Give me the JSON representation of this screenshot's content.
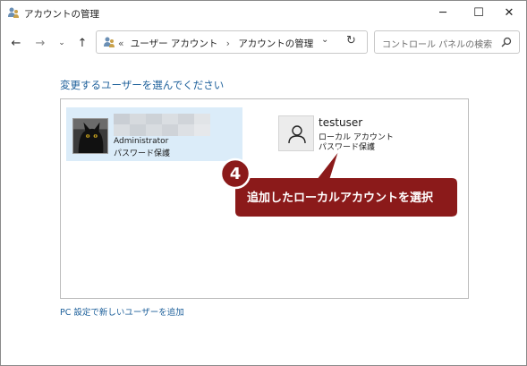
{
  "window": {
    "title": "アカウントの管理",
    "controls": {
      "minimize": "─",
      "maximize": "☐",
      "close": "✕"
    }
  },
  "nav": {
    "back_icon": "←",
    "forward_icon": "→",
    "recent_icon": "⌄",
    "up_icon": "↑"
  },
  "address": {
    "overflow": "«",
    "crumbs": [
      "ユーザー アカウント",
      "アカウントの管理"
    ],
    "separator": "›",
    "dropdown_icon": "⌄",
    "refresh_icon": "↻"
  },
  "search": {
    "placeholder": "コントロール パネルの検索"
  },
  "main": {
    "heading": "変更するユーザーを選んでください",
    "accounts": [
      {
        "name": "",
        "role": "Administrator",
        "password": "パスワード保護",
        "selected": true
      },
      {
        "name": "testuser",
        "role": "ローカル アカウント",
        "password": "パスワード保護",
        "selected": false
      }
    ],
    "add_user_link": "PC 設定で新しいユーザーを追加"
  },
  "annotation": {
    "step": "4",
    "text": "追加したローカルアカウントを選択",
    "color": "#8b1a1a"
  }
}
